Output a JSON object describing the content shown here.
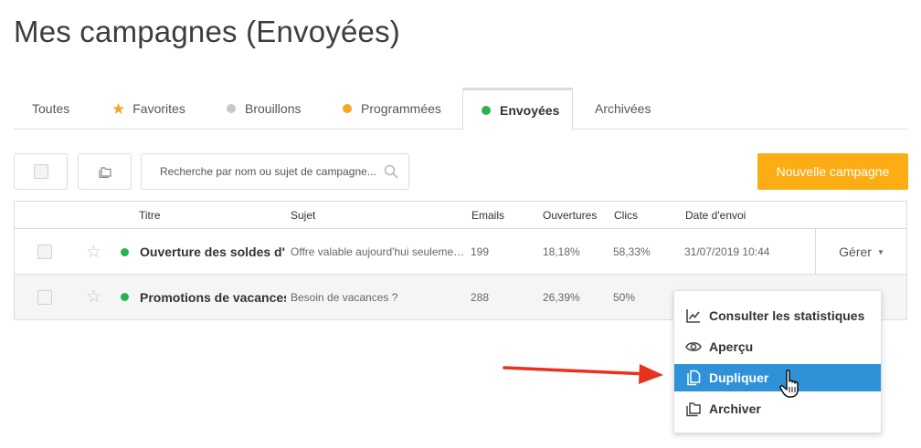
{
  "page": {
    "title": "Mes campagnes (Envoyées)"
  },
  "tabs": [
    {
      "label": "Toutes",
      "dot": null
    },
    {
      "label": "Favorites",
      "dot": "star"
    },
    {
      "label": "Brouillons",
      "dot": "#c8c8c8"
    },
    {
      "label": "Programmées",
      "dot": "#f5a623"
    },
    {
      "label": "Envoyées",
      "dot": "#2bb24c",
      "active": true
    },
    {
      "label": "Archivées",
      "dot": null
    }
  ],
  "toolbar": {
    "search_placeholder": "Recherche par nom ou sujet de campagne...",
    "new_campaign_label": "Nouvelle campagne",
    "accent_color": "#fdad14"
  },
  "table": {
    "headers": {
      "title": "Titre",
      "subject": "Sujet",
      "emails": "Emails",
      "opens": "Ouvertures",
      "clicks": "Clics",
      "sent_date": "Date d'envoi"
    },
    "rows": [
      {
        "title": "Ouverture des soldes d'…",
        "subject": "Offre valable aujourd'hui seuleme…",
        "emails": "199",
        "opens": "18,18%",
        "clicks": "58,33%",
        "sent_date": "31/07/2019 10:44",
        "manage_label": "Gérer"
      },
      {
        "title": "Promotions de vacances",
        "subject": "Besoin de vacances ?",
        "emails": "288",
        "opens": "26,39%",
        "clicks": "50%"
      }
    ]
  },
  "dropdown": {
    "items": [
      {
        "label": "Consulter les statistiques",
        "icon": "chart-icon"
      },
      {
        "label": "Aperçu",
        "icon": "eye-icon"
      },
      {
        "label": "Dupliquer",
        "icon": "duplicate-icon",
        "highlighted": true
      },
      {
        "label": "Archiver",
        "icon": "archive-icon"
      }
    ],
    "highlight_color": "#2f91d8"
  },
  "annotation": {
    "arrow_color": "#e8321e"
  }
}
